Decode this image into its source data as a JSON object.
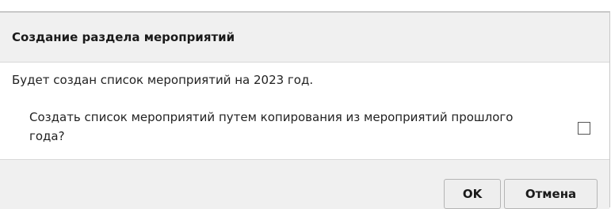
{
  "dialog": {
    "title": "Создание раздела мероприятий",
    "info_text": "Будет создан список мероприятий на 2023 год.",
    "question_text": "Создать список мероприятий путем копирования из мероприятий прошлого года?",
    "copy_checked": false,
    "buttons": {
      "ok_label": "OK",
      "cancel_label": "Отмена"
    }
  }
}
